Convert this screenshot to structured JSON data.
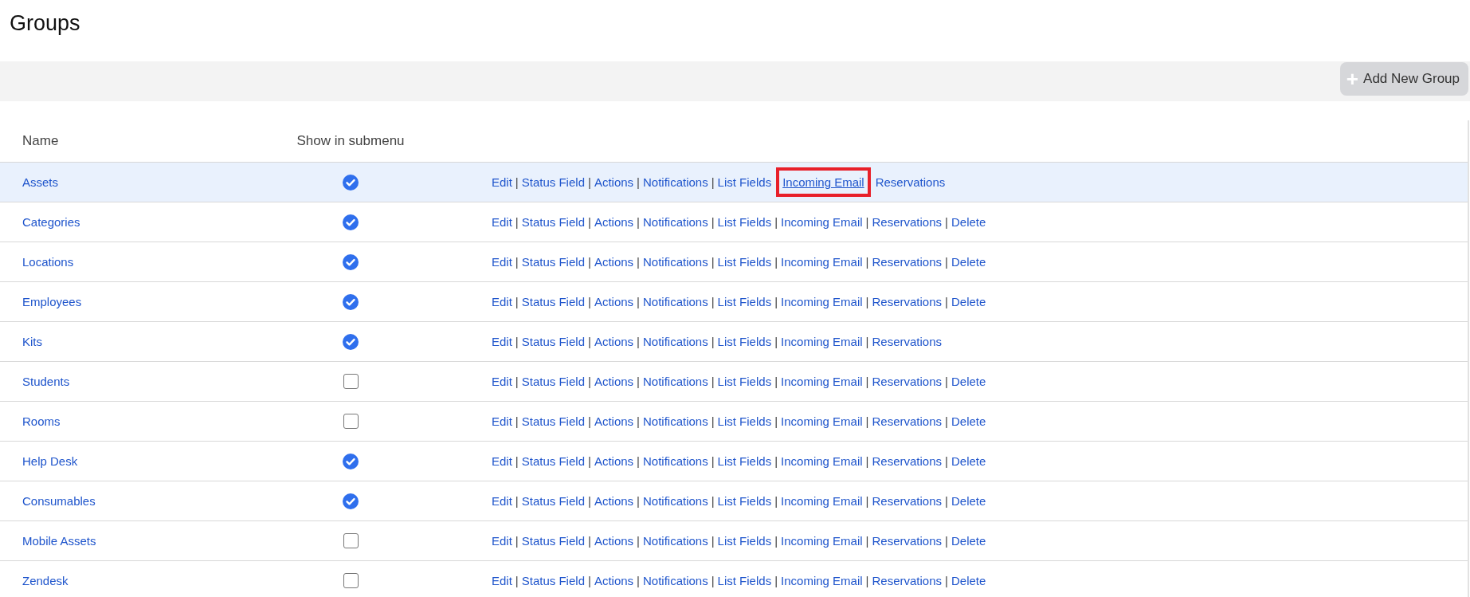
{
  "page": {
    "title": "Groups"
  },
  "toolbar": {
    "add_button": {
      "icon": "+",
      "label": "Add New Group"
    }
  },
  "table": {
    "columns": [
      "Name",
      "Show in submenu"
    ],
    "rows": [
      {
        "name": "Assets",
        "show_in_submenu": true,
        "highlighted": true,
        "actions": [
          {
            "kind": "link",
            "label": "Edit",
            "hovered": false,
            "outlined": false
          },
          {
            "kind": "separator",
            "label": "|"
          },
          {
            "kind": "link",
            "label": "Status Field",
            "hovered": false,
            "outlined": false
          },
          {
            "kind": "separator",
            "label": "|"
          },
          {
            "kind": "link",
            "label": "Actions",
            "hovered": false,
            "outlined": false
          },
          {
            "kind": "separator",
            "label": "|"
          },
          {
            "kind": "link",
            "label": "Notifications",
            "hovered": false,
            "outlined": false
          },
          {
            "kind": "separator",
            "label": "|"
          },
          {
            "kind": "link",
            "label": "List Fields",
            "hovered": false,
            "outlined": false
          },
          {
            "kind": "link",
            "label": "Incoming Email",
            "hovered": true,
            "outlined": true
          },
          {
            "kind": "link",
            "label": "Reservations",
            "hovered": false,
            "outlined": false
          }
        ]
      },
      {
        "name": "Categories",
        "show_in_submenu": true,
        "highlighted": false,
        "actions": [
          {
            "kind": "link",
            "label": "Edit",
            "hovered": false,
            "outlined": false
          },
          {
            "kind": "separator",
            "label": "|"
          },
          {
            "kind": "link",
            "label": "Status Field",
            "hovered": false,
            "outlined": false
          },
          {
            "kind": "separator",
            "label": "|"
          },
          {
            "kind": "link",
            "label": "Actions",
            "hovered": false,
            "outlined": false
          },
          {
            "kind": "separator",
            "label": "|"
          },
          {
            "kind": "link",
            "label": "Notifications",
            "hovered": false,
            "outlined": false
          },
          {
            "kind": "separator",
            "label": "|"
          },
          {
            "kind": "link",
            "label": "List Fields",
            "hovered": false,
            "outlined": false
          },
          {
            "kind": "separator",
            "label": "|"
          },
          {
            "kind": "link",
            "label": "Incoming Email",
            "hovered": false,
            "outlined": false
          },
          {
            "kind": "separator",
            "label": "|"
          },
          {
            "kind": "link",
            "label": "Reservations",
            "hovered": false,
            "outlined": false
          },
          {
            "kind": "separator",
            "label": "|"
          },
          {
            "kind": "link",
            "label": "Delete",
            "hovered": false,
            "outlined": false
          }
        ]
      },
      {
        "name": "Locations",
        "show_in_submenu": true,
        "highlighted": false,
        "actions": [
          {
            "kind": "link",
            "label": "Edit",
            "hovered": false,
            "outlined": false
          },
          {
            "kind": "separator",
            "label": "|"
          },
          {
            "kind": "link",
            "label": "Status Field",
            "hovered": false,
            "outlined": false
          },
          {
            "kind": "separator",
            "label": "|"
          },
          {
            "kind": "link",
            "label": "Actions",
            "hovered": false,
            "outlined": false
          },
          {
            "kind": "separator",
            "label": "|"
          },
          {
            "kind": "link",
            "label": "Notifications",
            "hovered": false,
            "outlined": false
          },
          {
            "kind": "separator",
            "label": "|"
          },
          {
            "kind": "link",
            "label": "List Fields",
            "hovered": false,
            "outlined": false
          },
          {
            "kind": "separator",
            "label": "|"
          },
          {
            "kind": "link",
            "label": "Incoming Email",
            "hovered": false,
            "outlined": false
          },
          {
            "kind": "separator",
            "label": "|"
          },
          {
            "kind": "link",
            "label": "Reservations",
            "hovered": false,
            "outlined": false
          },
          {
            "kind": "separator",
            "label": "|"
          },
          {
            "kind": "link",
            "label": "Delete",
            "hovered": false,
            "outlined": false
          }
        ]
      },
      {
        "name": "Employees",
        "show_in_submenu": true,
        "highlighted": false,
        "actions": [
          {
            "kind": "link",
            "label": "Edit",
            "hovered": false,
            "outlined": false
          },
          {
            "kind": "separator",
            "label": "|"
          },
          {
            "kind": "link",
            "label": "Status Field",
            "hovered": false,
            "outlined": false
          },
          {
            "kind": "separator",
            "label": "|"
          },
          {
            "kind": "link",
            "label": "Actions",
            "hovered": false,
            "outlined": false
          },
          {
            "kind": "separator",
            "label": "|"
          },
          {
            "kind": "link",
            "label": "Notifications",
            "hovered": false,
            "outlined": false
          },
          {
            "kind": "separator",
            "label": "|"
          },
          {
            "kind": "link",
            "label": "List Fields",
            "hovered": false,
            "outlined": false
          },
          {
            "kind": "separator",
            "label": "|"
          },
          {
            "kind": "link",
            "label": "Incoming Email",
            "hovered": false,
            "outlined": false
          },
          {
            "kind": "separator",
            "label": "|"
          },
          {
            "kind": "link",
            "label": "Reservations",
            "hovered": false,
            "outlined": false
          },
          {
            "kind": "separator",
            "label": "|"
          },
          {
            "kind": "link",
            "label": "Delete",
            "hovered": false,
            "outlined": false
          }
        ]
      },
      {
        "name": "Kits",
        "show_in_submenu": true,
        "highlighted": false,
        "actions": [
          {
            "kind": "link",
            "label": "Edit",
            "hovered": false,
            "outlined": false
          },
          {
            "kind": "separator",
            "label": "|"
          },
          {
            "kind": "link",
            "label": "Status Field",
            "hovered": false,
            "outlined": false
          },
          {
            "kind": "separator",
            "label": "|"
          },
          {
            "kind": "link",
            "label": "Actions",
            "hovered": false,
            "outlined": false
          },
          {
            "kind": "separator",
            "label": "|"
          },
          {
            "kind": "link",
            "label": "Notifications",
            "hovered": false,
            "outlined": false
          },
          {
            "kind": "separator",
            "label": "|"
          },
          {
            "kind": "link",
            "label": "List Fields",
            "hovered": false,
            "outlined": false
          },
          {
            "kind": "separator",
            "label": "|"
          },
          {
            "kind": "link",
            "label": "Incoming Email",
            "hovered": false,
            "outlined": false
          },
          {
            "kind": "separator",
            "label": "|"
          },
          {
            "kind": "link",
            "label": "Reservations",
            "hovered": false,
            "outlined": false
          }
        ]
      },
      {
        "name": "Students",
        "show_in_submenu": false,
        "highlighted": false,
        "actions": [
          {
            "kind": "link",
            "label": "Edit",
            "hovered": false,
            "outlined": false
          },
          {
            "kind": "separator",
            "label": "|"
          },
          {
            "kind": "link",
            "label": "Status Field",
            "hovered": false,
            "outlined": false
          },
          {
            "kind": "separator",
            "label": "|"
          },
          {
            "kind": "link",
            "label": "Actions",
            "hovered": false,
            "outlined": false
          },
          {
            "kind": "separator",
            "label": "|"
          },
          {
            "kind": "link",
            "label": "Notifications",
            "hovered": false,
            "outlined": false
          },
          {
            "kind": "separator",
            "label": "|"
          },
          {
            "kind": "link",
            "label": "List Fields",
            "hovered": false,
            "outlined": false
          },
          {
            "kind": "separator",
            "label": "|"
          },
          {
            "kind": "link",
            "label": "Incoming Email",
            "hovered": false,
            "outlined": false
          },
          {
            "kind": "separator",
            "label": "|"
          },
          {
            "kind": "link",
            "label": "Reservations",
            "hovered": false,
            "outlined": false
          },
          {
            "kind": "separator",
            "label": "|"
          },
          {
            "kind": "link",
            "label": "Delete",
            "hovered": false,
            "outlined": false
          }
        ]
      },
      {
        "name": "Rooms",
        "show_in_submenu": false,
        "highlighted": false,
        "actions": [
          {
            "kind": "link",
            "label": "Edit",
            "hovered": false,
            "outlined": false
          },
          {
            "kind": "separator",
            "label": "|"
          },
          {
            "kind": "link",
            "label": "Status Field",
            "hovered": false,
            "outlined": false
          },
          {
            "kind": "separator",
            "label": "|"
          },
          {
            "kind": "link",
            "label": "Actions",
            "hovered": false,
            "outlined": false
          },
          {
            "kind": "separator",
            "label": "|"
          },
          {
            "kind": "link",
            "label": "Notifications",
            "hovered": false,
            "outlined": false
          },
          {
            "kind": "separator",
            "label": "|"
          },
          {
            "kind": "link",
            "label": "List Fields",
            "hovered": false,
            "outlined": false
          },
          {
            "kind": "separator",
            "label": "|"
          },
          {
            "kind": "link",
            "label": "Incoming Email",
            "hovered": false,
            "outlined": false
          },
          {
            "kind": "separator",
            "label": "|"
          },
          {
            "kind": "link",
            "label": "Reservations",
            "hovered": false,
            "outlined": false
          },
          {
            "kind": "separator",
            "label": "|"
          },
          {
            "kind": "link",
            "label": "Delete",
            "hovered": false,
            "outlined": false
          }
        ]
      },
      {
        "name": "Help Desk",
        "show_in_submenu": true,
        "highlighted": false,
        "actions": [
          {
            "kind": "link",
            "label": "Edit",
            "hovered": false,
            "outlined": false
          },
          {
            "kind": "separator",
            "label": "|"
          },
          {
            "kind": "link",
            "label": "Status Field",
            "hovered": false,
            "outlined": false
          },
          {
            "kind": "separator",
            "label": "|"
          },
          {
            "kind": "link",
            "label": "Actions",
            "hovered": false,
            "outlined": false
          },
          {
            "kind": "separator",
            "label": "|"
          },
          {
            "kind": "link",
            "label": "Notifications",
            "hovered": false,
            "outlined": false
          },
          {
            "kind": "separator",
            "label": "|"
          },
          {
            "kind": "link",
            "label": "List Fields",
            "hovered": false,
            "outlined": false
          },
          {
            "kind": "separator",
            "label": "|"
          },
          {
            "kind": "link",
            "label": "Incoming Email",
            "hovered": false,
            "outlined": false
          },
          {
            "kind": "separator",
            "label": "|"
          },
          {
            "kind": "link",
            "label": "Reservations",
            "hovered": false,
            "outlined": false
          },
          {
            "kind": "separator",
            "label": "|"
          },
          {
            "kind": "link",
            "label": "Delete",
            "hovered": false,
            "outlined": false
          }
        ]
      },
      {
        "name": "Consumables",
        "show_in_submenu": true,
        "highlighted": false,
        "actions": [
          {
            "kind": "link",
            "label": "Edit",
            "hovered": false,
            "outlined": false
          },
          {
            "kind": "separator",
            "label": "|"
          },
          {
            "kind": "link",
            "label": "Status Field",
            "hovered": false,
            "outlined": false
          },
          {
            "kind": "separator",
            "label": "|"
          },
          {
            "kind": "link",
            "label": "Actions",
            "hovered": false,
            "outlined": false
          },
          {
            "kind": "separator",
            "label": "|"
          },
          {
            "kind": "link",
            "label": "Notifications",
            "hovered": false,
            "outlined": false
          },
          {
            "kind": "separator",
            "label": "|"
          },
          {
            "kind": "link",
            "label": "List Fields",
            "hovered": false,
            "outlined": false
          },
          {
            "kind": "separator",
            "label": "|"
          },
          {
            "kind": "link",
            "label": "Incoming Email",
            "hovered": false,
            "outlined": false
          },
          {
            "kind": "separator",
            "label": "|"
          },
          {
            "kind": "link",
            "label": "Reservations",
            "hovered": false,
            "outlined": false
          },
          {
            "kind": "separator",
            "label": "|"
          },
          {
            "kind": "link",
            "label": "Delete",
            "hovered": false,
            "outlined": false
          }
        ]
      },
      {
        "name": "Mobile Assets",
        "show_in_submenu": false,
        "highlighted": false,
        "actions": [
          {
            "kind": "link",
            "label": "Edit",
            "hovered": false,
            "outlined": false
          },
          {
            "kind": "separator",
            "label": "|"
          },
          {
            "kind": "link",
            "label": "Status Field",
            "hovered": false,
            "outlined": false
          },
          {
            "kind": "separator",
            "label": "|"
          },
          {
            "kind": "link",
            "label": "Actions",
            "hovered": false,
            "outlined": false
          },
          {
            "kind": "separator",
            "label": "|"
          },
          {
            "kind": "link",
            "label": "Notifications",
            "hovered": false,
            "outlined": false
          },
          {
            "kind": "separator",
            "label": "|"
          },
          {
            "kind": "link",
            "label": "List Fields",
            "hovered": false,
            "outlined": false
          },
          {
            "kind": "separator",
            "label": "|"
          },
          {
            "kind": "link",
            "label": "Incoming Email",
            "hovered": false,
            "outlined": false
          },
          {
            "kind": "separator",
            "label": "|"
          },
          {
            "kind": "link",
            "label": "Reservations",
            "hovered": false,
            "outlined": false
          },
          {
            "kind": "separator",
            "label": "|"
          },
          {
            "kind": "link",
            "label": "Delete",
            "hovered": false,
            "outlined": false
          }
        ]
      },
      {
        "name": "Zendesk",
        "show_in_submenu": false,
        "highlighted": false,
        "actions": [
          {
            "kind": "link",
            "label": "Edit",
            "hovered": false,
            "outlined": false
          },
          {
            "kind": "separator",
            "label": "|"
          },
          {
            "kind": "link",
            "label": "Status Field",
            "hovered": false,
            "outlined": false
          },
          {
            "kind": "separator",
            "label": "|"
          },
          {
            "kind": "link",
            "label": "Actions",
            "hovered": false,
            "outlined": false
          },
          {
            "kind": "separator",
            "label": "|"
          },
          {
            "kind": "link",
            "label": "Notifications",
            "hovered": false,
            "outlined": false
          },
          {
            "kind": "separator",
            "label": "|"
          },
          {
            "kind": "link",
            "label": "List Fields",
            "hovered": false,
            "outlined": false
          },
          {
            "kind": "separator",
            "label": "|"
          },
          {
            "kind": "link",
            "label": "Incoming Email",
            "hovered": false,
            "outlined": false
          },
          {
            "kind": "separator",
            "label": "|"
          },
          {
            "kind": "link",
            "label": "Reservations",
            "hovered": false,
            "outlined": false
          },
          {
            "kind": "separator",
            "label": "|"
          },
          {
            "kind": "link",
            "label": "Delete",
            "hovered": false,
            "outlined": false
          }
        ]
      }
    ]
  }
}
